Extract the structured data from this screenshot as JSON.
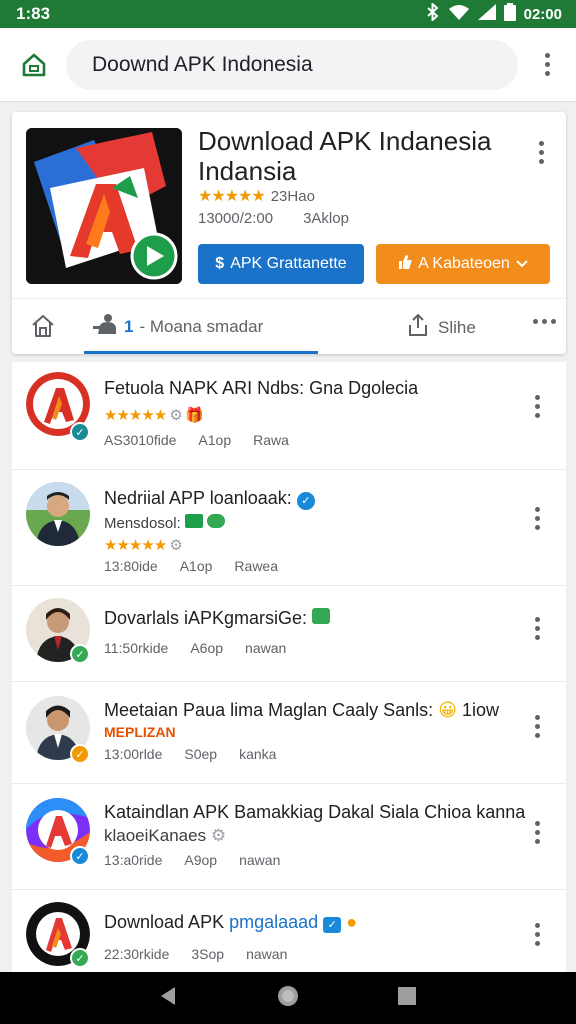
{
  "status_bar": {
    "time": "1:83",
    "clock": "02:00",
    "icons": [
      "bluetooth-icon",
      "wifi-icon",
      "signal-icon",
      "battery-icon"
    ]
  },
  "browser": {
    "url_text": "Doownd APK Indonesia"
  },
  "app_card": {
    "title_line1": "Download APK Indanesia",
    "title_line2": "Indansia",
    "stars": "★★★★★",
    "rating_count": "23Hao",
    "meta_left": "13000/2:00",
    "meta_right": "3Aklop",
    "primary_button": "APK Grattanette",
    "secondary_button": "A Kabateoen",
    "tabs": {
      "active_number": "1",
      "active_label": "- Moana smadar",
      "share_label": "Slihe"
    }
  },
  "list_items": [
    {
      "title": "Fetuola NAPK ARI Ndbs: Gna Dgolecia",
      "stars": "★★★★★",
      "extra": "",
      "subtitle": "",
      "meta": [
        "AS3010fide",
        "A1op",
        "Rawa"
      ]
    },
    {
      "title": "Nedriial APP loanloaak:",
      "subtitle": "Mensdosol:",
      "stars": "★★★★★",
      "meta": [
        "13:80ide",
        "A1op",
        "Rawea"
      ]
    },
    {
      "title": "Dovarlals iAPKgmarsiGe:",
      "subtitle": "",
      "stars": "",
      "meta": [
        "11:50rkide",
        "A6op",
        "nawan"
      ]
    },
    {
      "title": "Meetaian Paua lima Maglan Caaly Sanls:",
      "title_suffix": "1iow",
      "subtitle": "MEPLIZAN",
      "stars": "",
      "meta": [
        "13:00rlde",
        "S0ep",
        "kanka"
      ]
    },
    {
      "title": "Kataindlan APK Bamakkiag Dakal Siala Chioa kanna",
      "subtitle": "klaoeiKanaes",
      "stars": "",
      "meta": [
        "13:a0ride",
        "A9op",
        "nawan"
      ]
    },
    {
      "title": "Download APK",
      "title_accent": "pmgalaaad",
      "subtitle": "",
      "stars": "",
      "meta": [
        "22:30rkide",
        "3Sop",
        "nawan"
      ]
    }
  ],
  "colors": {
    "status_green": "#1e7a35",
    "accent_blue": "#1a73c8",
    "accent_orange": "#f28c1a",
    "star_orange": "#f29900",
    "verified_teal": "#1a8a94"
  }
}
